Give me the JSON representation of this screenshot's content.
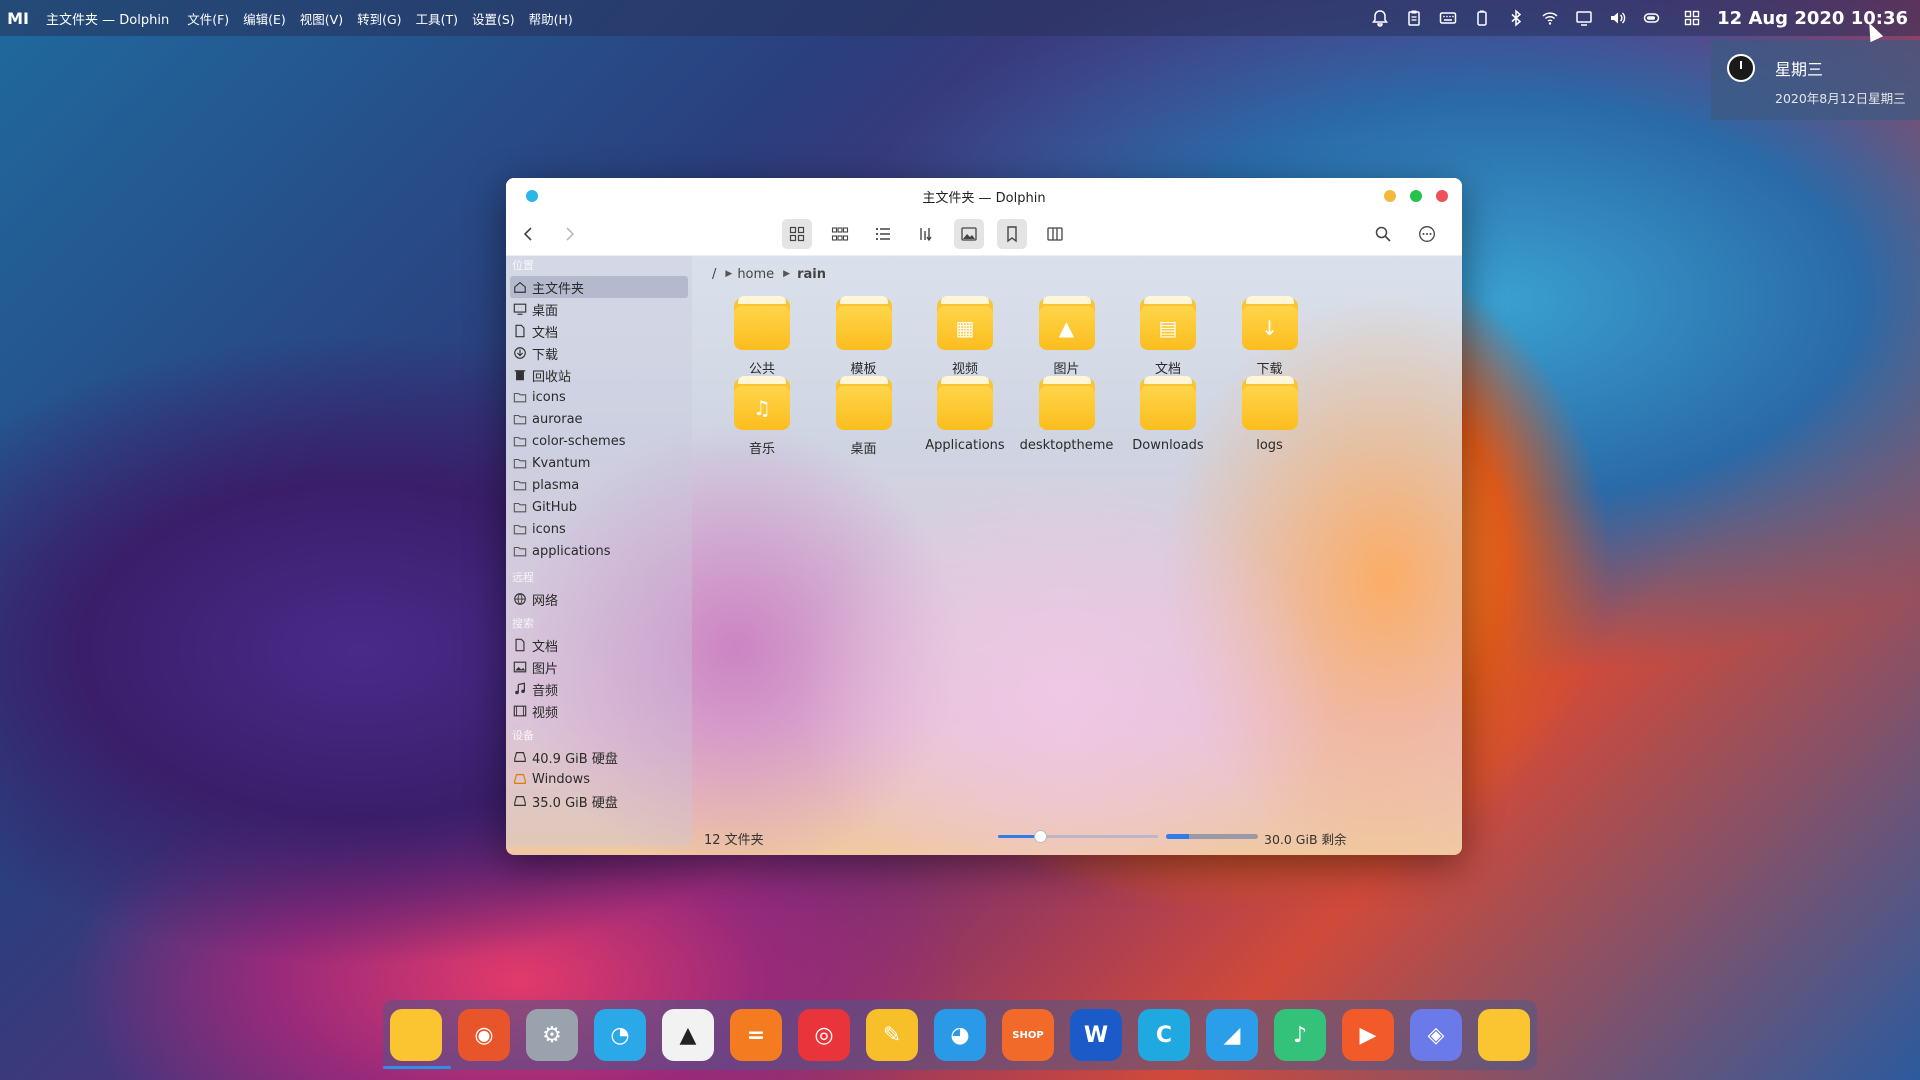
{
  "topbar": {
    "logo": "MI",
    "app_title": "主文件夹 — Dolphin",
    "menus": [
      "文件(F)",
      "编辑(E)",
      "视图(V)",
      "转到(G)",
      "工具(T)",
      "设置(S)",
      "帮助(H)"
    ],
    "clock": "12 Aug 2020 10:36",
    "tray_icons": [
      "bell-icon",
      "clipboard-icon",
      "keyboard-icon",
      "battery-icon",
      "bluetooth-icon",
      "wifi-icon",
      "display-icon",
      "volume-icon",
      "power-icon",
      "grid-icon"
    ]
  },
  "notification": {
    "title": "星期三",
    "date": "2020年8月12日星期三"
  },
  "window": {
    "title": "主文件夹 — Dolphin",
    "breadcrumb": [
      "/",
      "home",
      "rain"
    ],
    "status_count": "12 文件夹",
    "free_space": "30.0 GiB 剩余",
    "zoom_level": 0.26,
    "space_used": 0.25
  },
  "sidebar": {
    "sections": {
      "places": "位置",
      "remote": "远程",
      "search": "搜索",
      "devices": "设备"
    },
    "places": [
      "主文件夹",
      "桌面",
      "文档",
      "下载",
      "回收站",
      "icons",
      "aurorae",
      "color-schemes",
      "Kvantum",
      "plasma",
      "GitHub",
      "icons",
      "applications"
    ],
    "remote": [
      "网络"
    ],
    "search": [
      "文档",
      "图片",
      "音频",
      "视频"
    ],
    "devices": [
      "40.9 GiB 硬盘",
      "Windows",
      "35.0 GiB 硬盘"
    ]
  },
  "files": [
    {
      "name": "公共",
      "glyph": ""
    },
    {
      "name": "模板",
      "glyph": ""
    },
    {
      "name": "视频",
      "glyph": "▦"
    },
    {
      "name": "图片",
      "glyph": "▲"
    },
    {
      "name": "文档",
      "glyph": "▤"
    },
    {
      "name": "下载",
      "glyph": "↓"
    },
    {
      "name": "音乐",
      "glyph": "♫"
    },
    {
      "name": "桌面",
      "glyph": ""
    },
    {
      "name": "Applications",
      "glyph": ""
    },
    {
      "name": "desktoptheme",
      "glyph": ""
    },
    {
      "name": "Downloads",
      "glyph": ""
    },
    {
      "name": "logs",
      "glyph": ""
    }
  ],
  "dock": {
    "apps": [
      {
        "name": "files",
        "color": "#fbc531",
        "glyph": ""
      },
      {
        "name": "firefox",
        "color": "#e8552a",
        "glyph": "◉"
      },
      {
        "name": "settings",
        "color": "#9aa3ad",
        "glyph": "⚙"
      },
      {
        "name": "qq",
        "color": "#2aa8e8",
        "glyph": "◔"
      },
      {
        "name": "inkscape",
        "color": "#f2f2f2",
        "glyph": "▲"
      },
      {
        "name": "notes",
        "color": "#f47b20",
        "glyph": "="
      },
      {
        "name": "netease-music",
        "color": "#e8343a",
        "glyph": "◎"
      },
      {
        "name": "editor",
        "color": "#f7c02a",
        "glyph": "✎"
      },
      {
        "name": "github",
        "color": "#2a9ae8",
        "glyph": "◕"
      },
      {
        "name": "shop",
        "color": "#f26a2a",
        "glyph": "SHOP"
      },
      {
        "name": "word",
        "color": "#1a5bc8",
        "glyph": "W"
      },
      {
        "name": "browser",
        "color": "#20a8e0",
        "glyph": "C"
      },
      {
        "name": "telegram",
        "color": "#2a9ee8",
        "glyph": "◢"
      },
      {
        "name": "music",
        "color": "#34c27a",
        "glyph": "♪"
      },
      {
        "name": "video",
        "color": "#f25a2a",
        "glyph": "▶"
      },
      {
        "name": "photos",
        "color": "#6a7ae8",
        "glyph": "◈"
      },
      {
        "name": "files-2",
        "color": "#fbc531",
        "glyph": ""
      }
    ]
  }
}
